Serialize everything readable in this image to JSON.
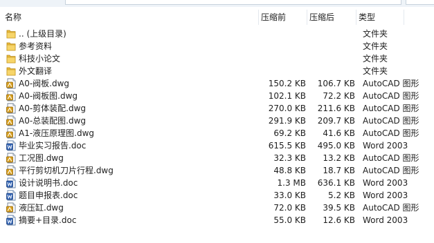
{
  "columns": {
    "name": "名称",
    "compressed": "压缩前",
    "after": "压缩后",
    "type": "类型"
  },
  "files": [
    {
      "name": ".. (上级目录)",
      "compressed": "",
      "after": "",
      "type": "文件夹",
      "icon": "folder-icon"
    },
    {
      "name": "参考资料",
      "compressed": "",
      "after": "",
      "type": "文件夹",
      "icon": "folder-icon"
    },
    {
      "name": "科技小论文",
      "compressed": "",
      "after": "",
      "type": "文件夹",
      "icon": "folder-icon"
    },
    {
      "name": "外文翻译",
      "compressed": "",
      "after": "",
      "type": "文件夹",
      "icon": "folder-icon"
    },
    {
      "name": "A0-阀板.dwg",
      "compressed": "150.2 KB",
      "after": "106.7 KB",
      "type": "AutoCAD 图形",
      "icon": "dwg-file-icon"
    },
    {
      "name": "A0-阀板图.dwg",
      "compressed": "102.1 KB",
      "after": "72.2 KB",
      "type": "AutoCAD 图形",
      "icon": "dwg-file-icon"
    },
    {
      "name": "A0-剪体装配.dwg",
      "compressed": "270.0 KB",
      "after": "211.6 KB",
      "type": "AutoCAD 图形",
      "icon": "dwg-file-icon"
    },
    {
      "name": "A0-总装配图.dwg",
      "compressed": "291.9 KB",
      "after": "209.7 KB",
      "type": "AutoCAD 图形",
      "icon": "dwg-file-icon"
    },
    {
      "name": "A1-液压原理图.dwg",
      "compressed": "69.2 KB",
      "after": "41.6 KB",
      "type": "AutoCAD 图形",
      "icon": "dwg-file-icon"
    },
    {
      "name": "毕业实习报告.doc",
      "compressed": "615.5 KB",
      "after": "495.0 KB",
      "type": "Word 2003",
      "icon": "doc-file-icon"
    },
    {
      "name": "工况图.dwg",
      "compressed": "32.3 KB",
      "after": "13.2 KB",
      "type": "AutoCAD 图形",
      "icon": "dwg-file-icon"
    },
    {
      "name": "平行剪切机刀片行程.dwg",
      "compressed": "48.8 KB",
      "after": "18.7 KB",
      "type": "AutoCAD 图形",
      "icon": "dwg-file-icon"
    },
    {
      "name": "设计说明书.doc",
      "compressed": "1.3 MB",
      "after": "636.1 KB",
      "type": "Word 2003",
      "icon": "doc-file-icon"
    },
    {
      "name": "题目申报表.doc",
      "compressed": "33.0 KB",
      "after": "5.2 KB",
      "type": "Word 2003",
      "icon": "doc-file-icon"
    },
    {
      "name": "液压缸.dwg",
      "compressed": "72.0 KB",
      "after": "39.5 KB",
      "type": "AutoCAD 图形",
      "icon": "dwg-file-icon"
    },
    {
      "name": "摘要+目录.doc",
      "compressed": "55.0 KB",
      "after": "12.6 KB",
      "type": "Word 2003",
      "icon": "doc-file-icon"
    }
  ]
}
